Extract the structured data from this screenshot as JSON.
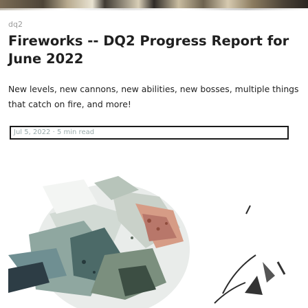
{
  "post": {
    "tag": "dq2",
    "title": "Fireworks -- DQ2 Progress Report for June 2022",
    "summary": "New levels, new cannons, new abilities, new bosses, multiple things that catch on fire, and more!",
    "meta": {
      "date": "Jul 5, 2022",
      "separator": "·",
      "read_time": "5 min read"
    }
  },
  "colors": {
    "title": "#1f1f1f",
    "meta_border": "#1a1a1a",
    "meta_text": "#99aaaa"
  },
  "icons": {
    "hero": "game-art-illustration"
  }
}
